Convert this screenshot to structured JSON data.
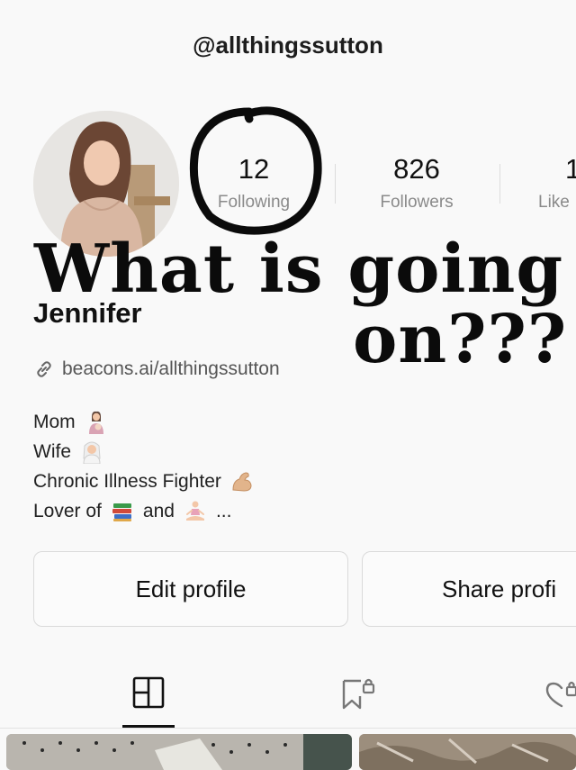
{
  "header": {
    "handle": "@allthingssutton"
  },
  "stats": [
    {
      "value": "12",
      "label": "Following"
    },
    {
      "value": "826",
      "label": "Followers"
    },
    {
      "value": "1",
      "label": "Like"
    }
  ],
  "overlay": {
    "line1": "What is going",
    "line2": "on???"
  },
  "profile": {
    "name": "Jennifer",
    "link": "beacons.ai/allthingssutton",
    "bio": {
      "line1": "Mom",
      "line2": "Wife",
      "line3": "Chronic Illness Fighter",
      "line4_a": "Lover of",
      "line4_b": "and",
      "line4_c": "..."
    }
  },
  "buttons": {
    "edit": "Edit profile",
    "share": "Share profi"
  },
  "icons": {
    "link": "link-icon",
    "grid_tab": "grid-icon",
    "saved_tab": "bookmark-lock-icon",
    "liked_tab": "heart-lock-icon"
  },
  "colors": {
    "accent": "#111111",
    "muted": "#8a8a8a",
    "border": "#dadada",
    "annotation": "#0b0b0b"
  }
}
